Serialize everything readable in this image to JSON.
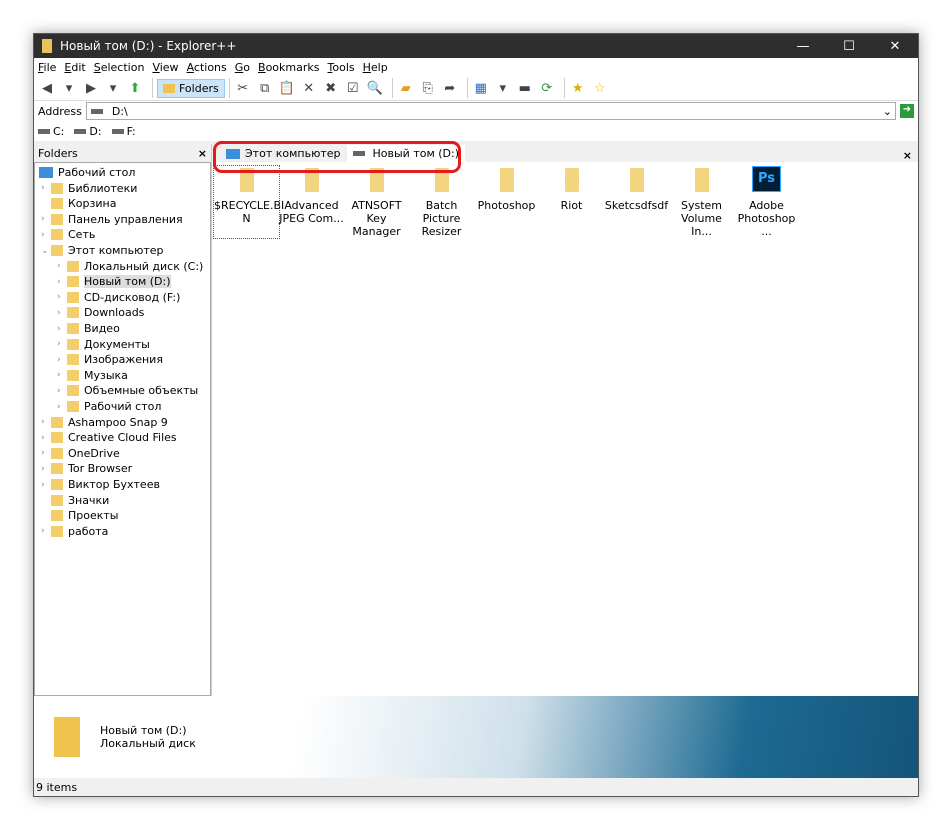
{
  "window": {
    "title": "Новый том (D:) - Explorer++",
    "min": "—",
    "max": "☐",
    "close": "✕"
  },
  "menu": [
    "File",
    "Edit",
    "Selection",
    "View",
    "Actions",
    "Go",
    "Bookmarks",
    "Tools",
    "Help"
  ],
  "toolbar": {
    "folders_label": "Folders"
  },
  "address": {
    "label": "Address",
    "value": "D:\\"
  },
  "drives": [
    "C:",
    "D:",
    "F:"
  ],
  "sidebar": {
    "title": "Folders",
    "close": "×",
    "items": [
      {
        "label": "Рабочий стол",
        "level": 0,
        "arrow": ""
      },
      {
        "label": "Библиотеки",
        "level": 1,
        "arrow": ">"
      },
      {
        "label": "Корзина",
        "level": 1,
        "arrow": ""
      },
      {
        "label": "Панель управления",
        "level": 1,
        "arrow": ">"
      },
      {
        "label": "Сеть",
        "level": 1,
        "arrow": ">"
      },
      {
        "label": "Этот компьютер",
        "level": 1,
        "arrow": "v"
      },
      {
        "label": "Локальный диск (C:)",
        "level": 2,
        "arrow": ">"
      },
      {
        "label": "Новый том (D:)",
        "level": 2,
        "arrow": ">",
        "selected": true
      },
      {
        "label": "CD-дисковод (F:)",
        "level": 2,
        "arrow": ">"
      },
      {
        "label": "Downloads",
        "level": 2,
        "arrow": ">"
      },
      {
        "label": "Видео",
        "level": 2,
        "arrow": ">"
      },
      {
        "label": "Документы",
        "level": 2,
        "arrow": ">"
      },
      {
        "label": "Изображения",
        "level": 2,
        "arrow": ">"
      },
      {
        "label": "Музыка",
        "level": 2,
        "arrow": ">"
      },
      {
        "label": "Объемные объекты",
        "level": 2,
        "arrow": ">"
      },
      {
        "label": "Рабочий стол",
        "level": 2,
        "arrow": ">"
      },
      {
        "label": "Ashampoo Snap 9",
        "level": 1,
        "arrow": ">"
      },
      {
        "label": "Creative Cloud Files",
        "level": 1,
        "arrow": ">"
      },
      {
        "label": "OneDrive",
        "level": 1,
        "arrow": ">"
      },
      {
        "label": "Tor Browser",
        "level": 1,
        "arrow": ">"
      },
      {
        "label": "Виктор Бухтеев",
        "level": 1,
        "arrow": ">"
      },
      {
        "label": "Значки",
        "level": 1,
        "arrow": ""
      },
      {
        "label": "Проекты",
        "level": 1,
        "arrow": ""
      },
      {
        "label": "работа",
        "level": 1,
        "arrow": ">"
      }
    ]
  },
  "tabs": [
    {
      "label": "Этот компьютер",
      "active": false
    },
    {
      "label": "Новый том (D:)",
      "active": true
    }
  ],
  "tabs_close": "×",
  "files": [
    {
      "l1": "$RECYCLE.BI",
      "l2": "N",
      "icon": "folder"
    },
    {
      "l1": "Advanced",
      "l2": "JPEG Com...",
      "icon": "folder"
    },
    {
      "l1": "ATNSOFT Key",
      "l2": "Manager",
      "icon": "folder"
    },
    {
      "l1": "Batch Picture",
      "l2": "Resizer",
      "icon": "folder"
    },
    {
      "l1": "Photoshop",
      "l2": "",
      "icon": "folder"
    },
    {
      "l1": "Riot",
      "l2": "",
      "icon": "folder"
    },
    {
      "l1": "Sketcsdfsdf",
      "l2": "",
      "icon": "folder"
    },
    {
      "l1": "System",
      "l2": "Volume In...",
      "icon": "folder"
    },
    {
      "l1": "Adobe",
      "l2": "Photoshop ...",
      "icon": "photoshop",
      "badge": "Ps"
    }
  ],
  "info": {
    "name": "Новый том (D:)",
    "type": "Локальный диск"
  },
  "status": "9 items"
}
